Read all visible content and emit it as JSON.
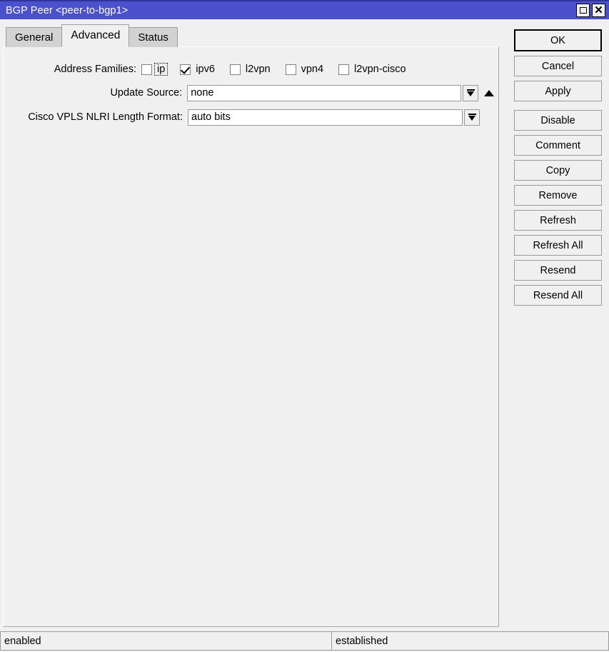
{
  "window": {
    "title": "BGP Peer <peer-to-bgp1>",
    "controls": [
      {
        "name": "maximize-button",
        "icon": "square-icon"
      },
      {
        "name": "close-button",
        "icon": "close-icon"
      }
    ]
  },
  "tabs": [
    {
      "label": "General",
      "active": false
    },
    {
      "label": "Advanced",
      "active": true
    },
    {
      "label": "Status",
      "active": false
    }
  ],
  "form": {
    "address_families": {
      "label": "Address Families:",
      "options": [
        {
          "label": "ip",
          "checked": false,
          "focused": true
        },
        {
          "label": "ipv6",
          "checked": true,
          "focused": false
        },
        {
          "label": "l2vpn",
          "checked": false,
          "focused": false
        },
        {
          "label": "vpn4",
          "checked": false,
          "focused": false
        },
        {
          "label": "l2vpn-cisco",
          "checked": false,
          "focused": false
        }
      ]
    },
    "update_source": {
      "label": "Update Source:",
      "value": "none"
    },
    "cisco_vpls_nlri": {
      "label": "Cisco VPLS NLRI Length Format:",
      "value": "auto bits"
    }
  },
  "buttons": [
    {
      "label": "OK",
      "default": true
    },
    {
      "label": "Cancel",
      "default": false
    },
    {
      "label": "Apply",
      "default": false
    },
    {
      "label": "Disable",
      "default": false
    },
    {
      "label": "Comment",
      "default": false
    },
    {
      "label": "Copy",
      "default": false
    },
    {
      "label": "Remove",
      "default": false
    },
    {
      "label": "Refresh",
      "default": false
    },
    {
      "label": "Refresh All",
      "default": false
    },
    {
      "label": "Resend",
      "default": false
    },
    {
      "label": "Resend All",
      "default": false
    }
  ],
  "statusbar": {
    "left": "enabled",
    "right": "established"
  },
  "colors": {
    "titlebar": "#4b50cc",
    "window_bg": "#f0f0f0",
    "field_bg": "#ffffff"
  }
}
